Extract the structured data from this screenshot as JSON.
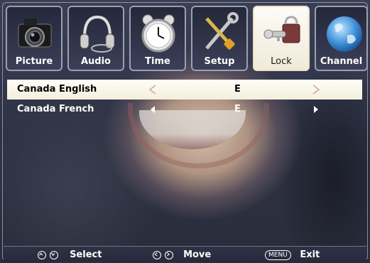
{
  "tabs": [
    {
      "label": "Picture",
      "icon": "camera-icon",
      "active": false
    },
    {
      "label": "Audio",
      "icon": "headphones-icon",
      "active": false
    },
    {
      "label": "Time",
      "icon": "alarm-clock-icon",
      "active": false
    },
    {
      "label": "Setup",
      "icon": "tools-icon",
      "active": false
    },
    {
      "label": "Lock",
      "icon": "padlock-key-icon",
      "active": true
    },
    {
      "label": "Channel",
      "icon": "globe-icon",
      "active": false
    }
  ],
  "rows": [
    {
      "name": "Canada English",
      "value": "E",
      "selected": true
    },
    {
      "name": "Canada French",
      "value": "E",
      "selected": false
    }
  ],
  "footer": {
    "select_label": "Select",
    "move_label": "Move",
    "menu_button": "MENU",
    "exit_label": "Exit"
  },
  "colors": {
    "accent_selected": "#f3efdc",
    "arrow_selected": "#c9a9a6",
    "panel": "#2d3246"
  }
}
